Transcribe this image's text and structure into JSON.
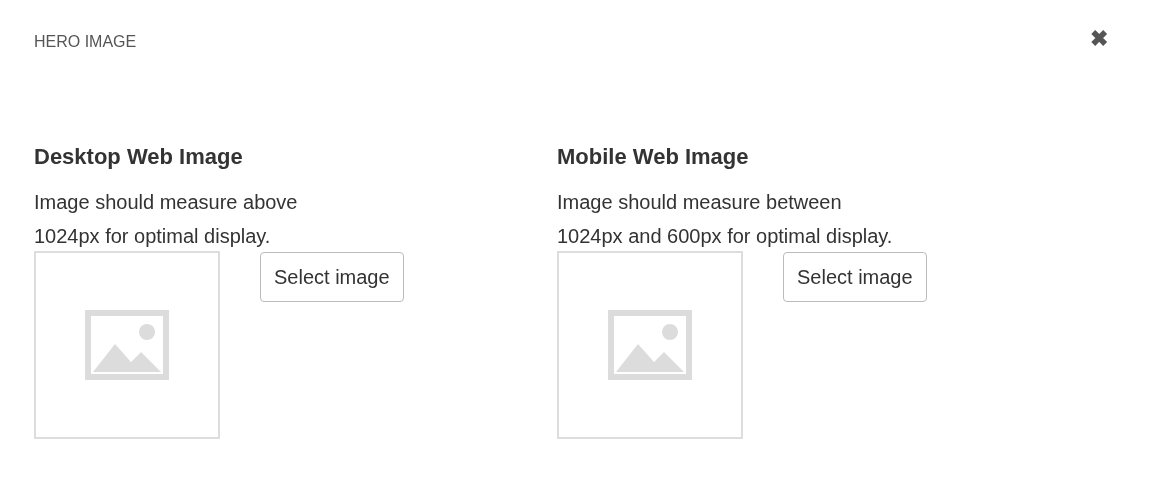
{
  "dialog": {
    "title": "HERO IMAGE",
    "close": "✖"
  },
  "sections": [
    {
      "heading": "Desktop Web Image",
      "description": "Image should measure above\n1024px for optimal display.",
      "button": "Select image"
    },
    {
      "heading": "Mobile Web Image",
      "description": "Image should measure between\n1024px and 600px for optimal display.",
      "button": "Select image"
    }
  ]
}
